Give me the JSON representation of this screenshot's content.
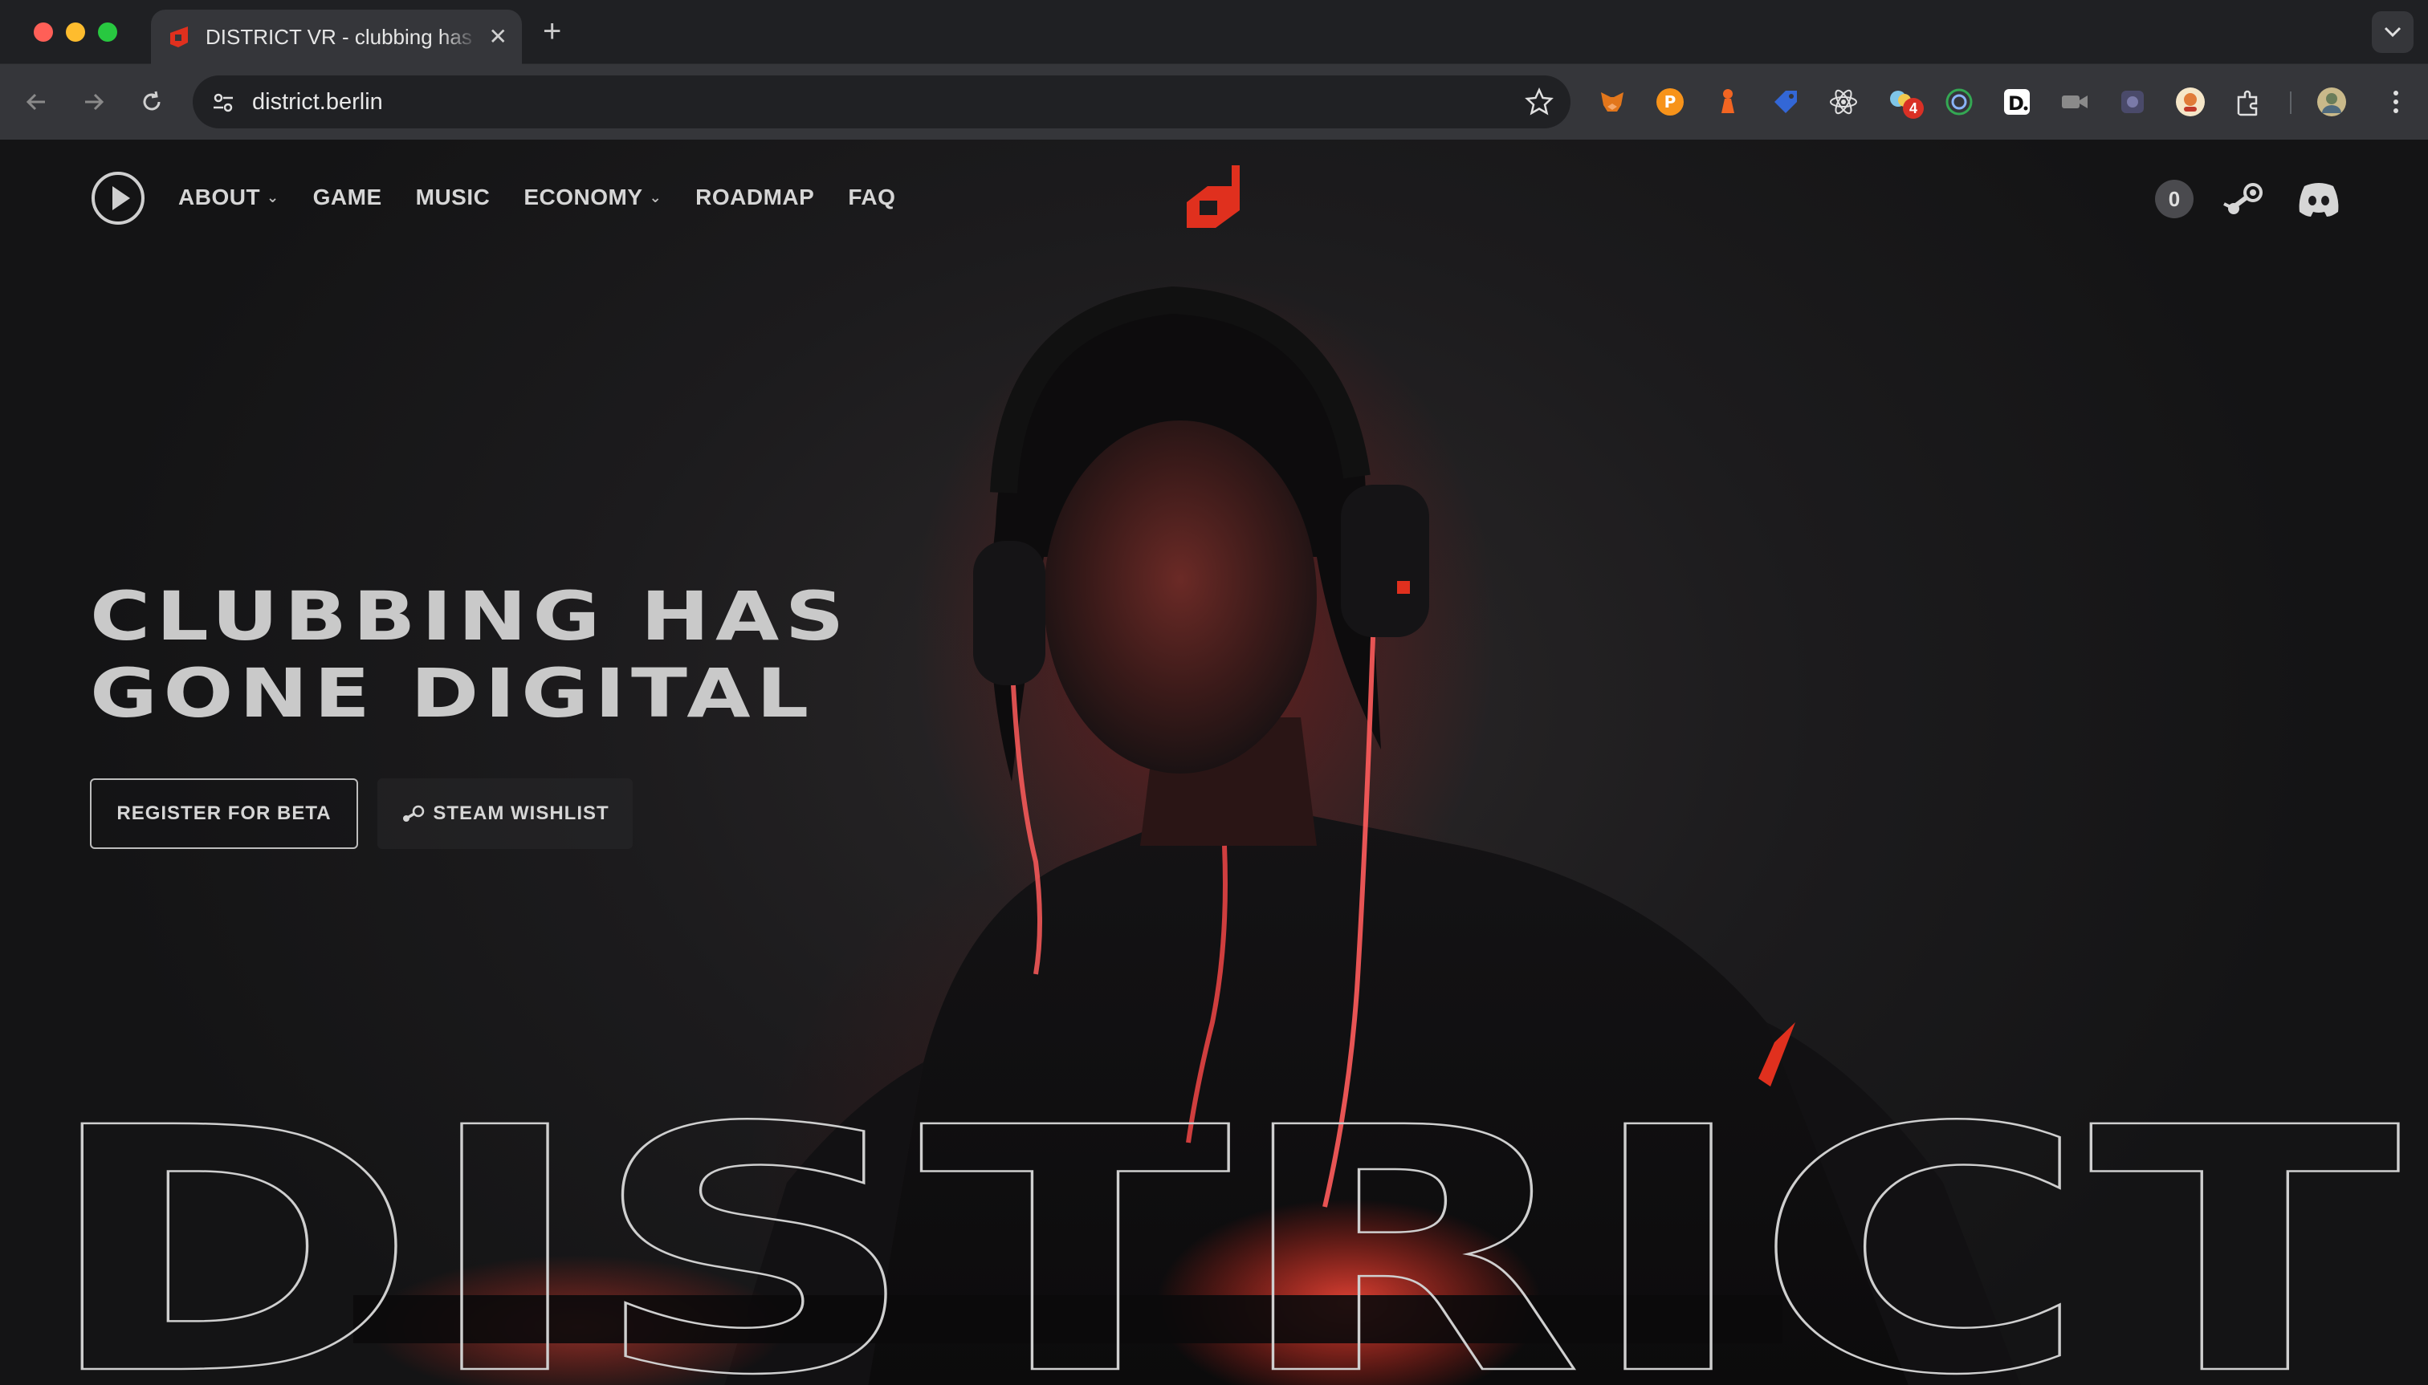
{
  "browser": {
    "tab_title": "DISTRICT VR - clubbing has gone digital",
    "tab_close": "✕",
    "new_tab": "+",
    "url": "district.berlin",
    "extension_badge": "4"
  },
  "nav": {
    "items": [
      {
        "label": "ABOUT",
        "has_dropdown": true
      },
      {
        "label": "GAME",
        "has_dropdown": false
      },
      {
        "label": "MUSIC",
        "has_dropdown": false
      },
      {
        "label": "ECONOMY",
        "has_dropdown": true
      },
      {
        "label": "ROADMAP",
        "has_dropdown": false
      },
      {
        "label": "FAQ",
        "has_dropdown": false
      }
    ],
    "chevron": "⌄",
    "counter": "0"
  },
  "hero": {
    "title_line1": "CLUBBING HAS",
    "title_line2": "GONE DIGITAL",
    "register_button": "REGISTER FOR BETA",
    "steam_button": "STEAM WISHLIST",
    "big_word": "DISTRICT"
  },
  "colors": {
    "accent_red": "#e0301e",
    "page_bg": "#1c1b1d",
    "text": "#c9c9c9"
  }
}
